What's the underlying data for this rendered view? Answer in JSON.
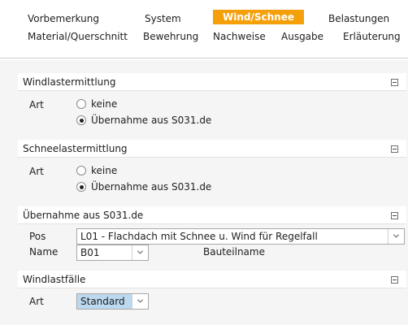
{
  "tabs": {
    "row1": [
      "Vorbemerkung",
      "System",
      "Wind/Schnee",
      "Belastungen"
    ],
    "row2": [
      "Material/Querschnitt",
      "Bewehrung",
      "Nachweise",
      "Ausgabe",
      "Erläuterung"
    ],
    "active": "Wind/Schnee",
    "active_color": "#f5a00a"
  },
  "sections": {
    "wind": {
      "title": "Windlastermittlung",
      "art_label": "Art",
      "options": [
        "keine",
        "Übernahme aus S031.de"
      ],
      "selected": "Übernahme aus S031.de"
    },
    "schnee": {
      "title": "Schneelastermittlung",
      "art_label": "Art",
      "options": [
        "keine",
        "Übernahme aus S031.de"
      ],
      "selected": "Übernahme aus S031.de"
    },
    "uebernahme": {
      "title": "Übernahme aus S031.de",
      "pos_label": "Pos",
      "pos_value": "L01 - Flachdach mit Schnee u. Wind für Regelfall",
      "name_label": "Name",
      "name_value": "B01",
      "bauteilname_label": "Bauteilname"
    },
    "windlastfaelle": {
      "title": "Windlastfälle",
      "art_label": "Art",
      "art_value": "Standard"
    }
  },
  "icons": {
    "collapse": "collapse-icon",
    "dropdown": "chevron-down-icon"
  }
}
